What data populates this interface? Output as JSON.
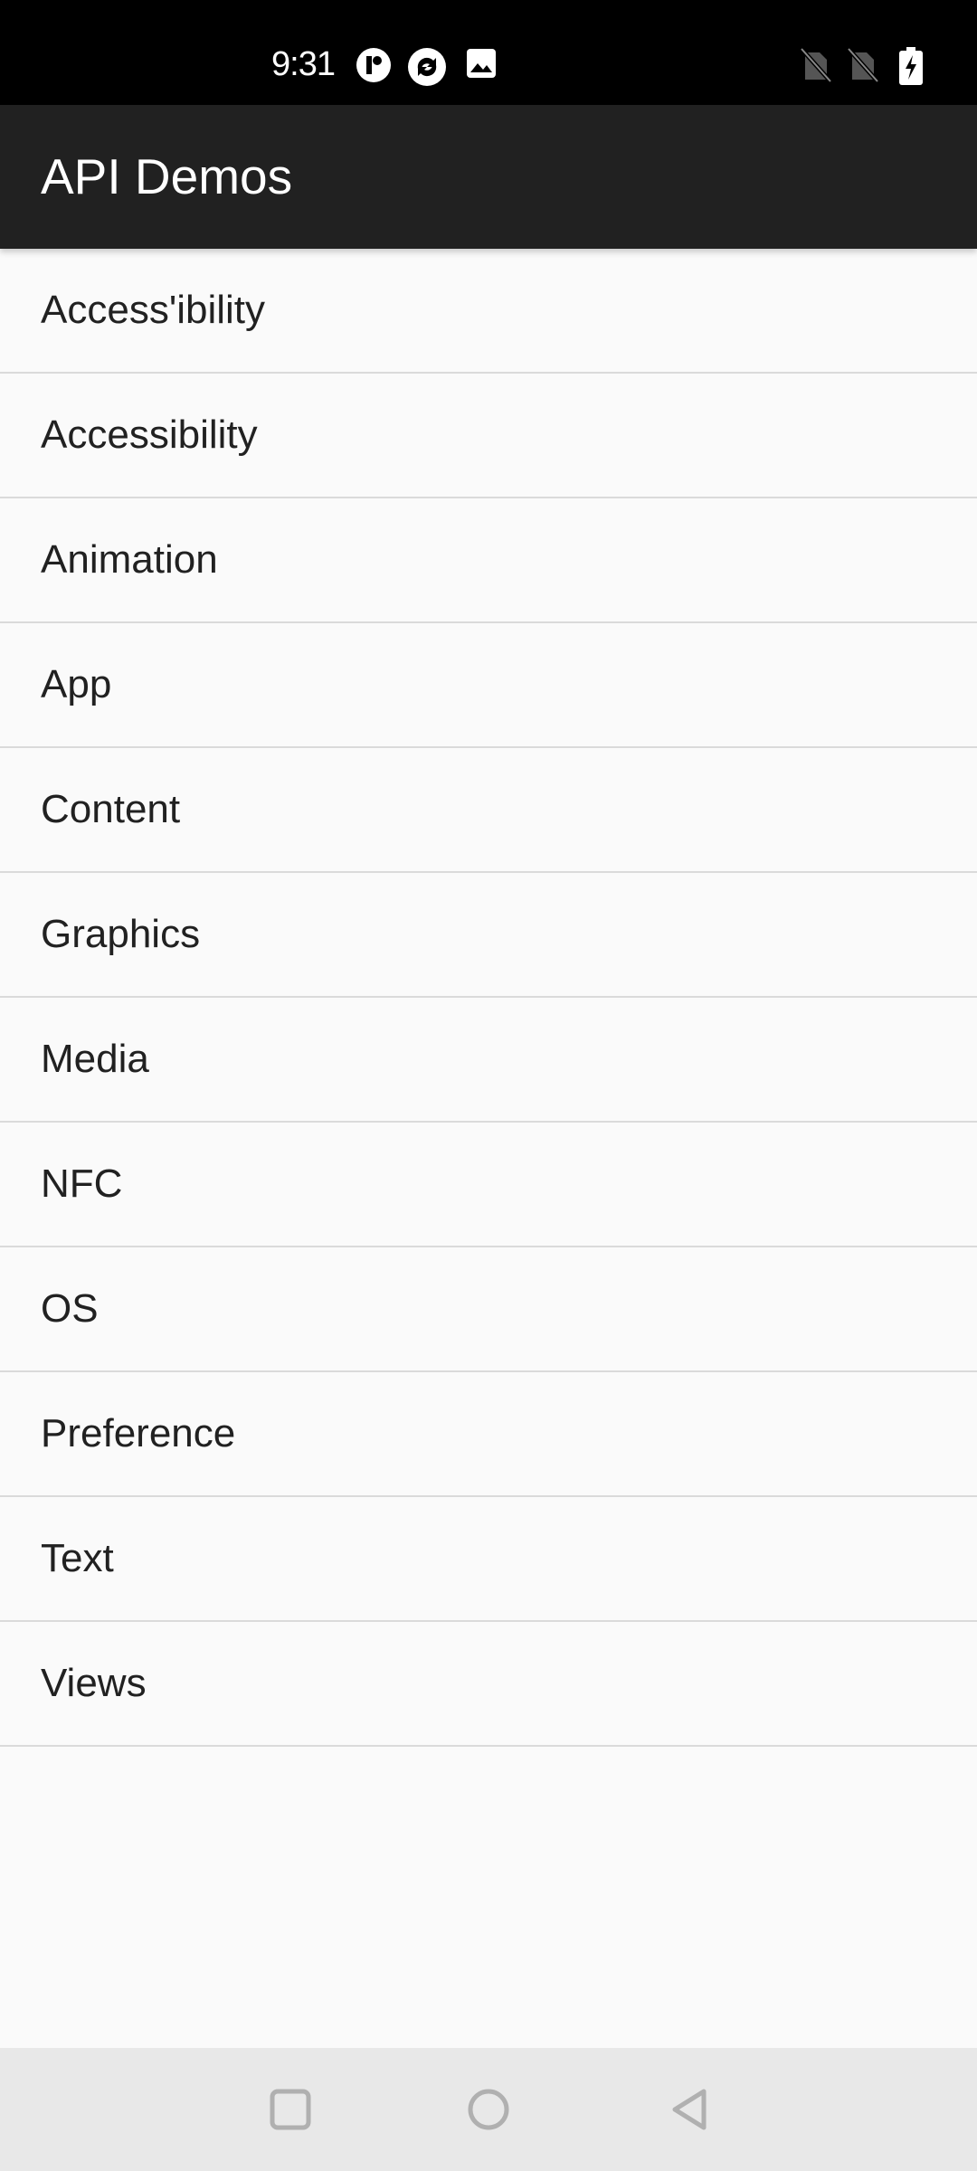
{
  "status_bar": {
    "time": "9:31",
    "notification_icons": [
      "app-notification-icon",
      "sync-icon",
      "image-icon"
    ],
    "system_icons": [
      "no-sim-icon",
      "no-sim-icon",
      "battery-charging-icon"
    ]
  },
  "app_bar": {
    "title": "API Demos"
  },
  "list": {
    "items": [
      {
        "label": "Access'ibility"
      },
      {
        "label": "Accessibility"
      },
      {
        "label": "Animation"
      },
      {
        "label": "App"
      },
      {
        "label": "Content"
      },
      {
        "label": "Graphics"
      },
      {
        "label": "Media"
      },
      {
        "label": "NFC"
      },
      {
        "label": "OS"
      },
      {
        "label": "Preference"
      },
      {
        "label": "Text"
      },
      {
        "label": "Views"
      }
    ]
  },
  "nav_bar": {
    "buttons": [
      "recents-icon",
      "home-icon",
      "back-icon"
    ]
  },
  "colors": {
    "status_bar": "#000000",
    "app_bar": "#212121",
    "background": "#fafafa",
    "divider": "#dadada",
    "nav_bar": "#e8e8e8"
  }
}
